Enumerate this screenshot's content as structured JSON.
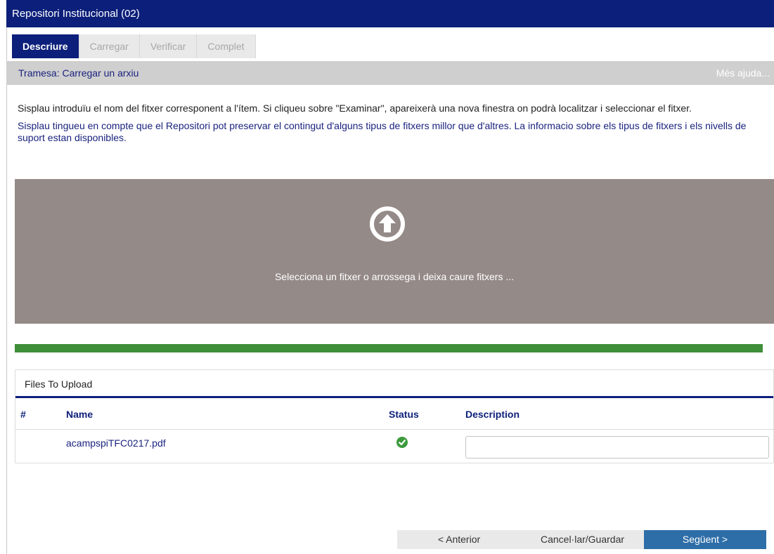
{
  "window": {
    "title": "Repositori Institucional (02)"
  },
  "tabs": [
    {
      "label": "Descriure",
      "active": true
    },
    {
      "label": "Carregar",
      "active": false
    },
    {
      "label": "Verificar",
      "active": false
    },
    {
      "label": "Complet",
      "active": false
    }
  ],
  "subheader": {
    "title": "Tramesa: Carregar un arxiu",
    "help_link": "Més ajuda..."
  },
  "instructions": {
    "paragraph1": "Sisplau introduïu el nom del fitxer corresponent a l'ítem. Si cliqueu sobre \"Examinar\", apareixerà una nova finestra on podrà localitzar i seleccionar el fitxer.",
    "paragraph2": "Sisplau tingueu en compte que el Repositori pot preservar el contingut d'alguns tipus de fitxers millor que d'altres. La informacio sobre els tipus de fitxers i els nivells de suport estan disponibles."
  },
  "dropzone": {
    "icon": "upload-arrow-icon",
    "text": "Selecciona un fitxer o arrossega i deixa caure fitxers ..."
  },
  "progress": {
    "percent": 100,
    "color": "#3f8f3a"
  },
  "files_panel": {
    "title": "Files To Upload",
    "columns": {
      "index": "#",
      "name": "Name",
      "status": "Status",
      "description": "Description"
    },
    "rows": [
      {
        "index": "",
        "name": "acampspiTFC0217.pdf",
        "status": "success",
        "status_icon": "check-circle-icon",
        "description": ""
      }
    ]
  },
  "footer": {
    "prev_label": "< Anterior",
    "cancel_label": "Cancel·lar/Guardar",
    "next_label": "Següent >"
  },
  "colors": {
    "primary": "#0c1f7a",
    "dropzone": "#948a88",
    "success": "#3c9a3c",
    "next_button": "#2e6ea8"
  }
}
